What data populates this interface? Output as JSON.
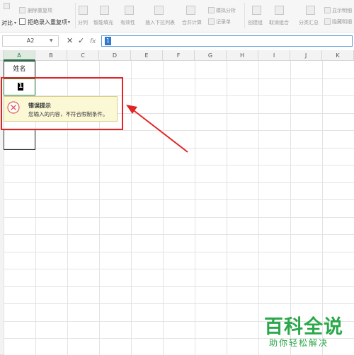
{
  "ribbon": {
    "compare_label": "对比",
    "remove_duplicates": "删除重复项",
    "reject_duplicates": "拒绝录入重复项",
    "split": "分列",
    "smart_fill": "智能填充",
    "validity": "有效性",
    "insert_dropdown": "插入下拉列表",
    "merge_calc": "合并计算",
    "simulate_analysis": "模拟分析",
    "record_form": "记录单",
    "create_group": "创建组",
    "ungroup": "取消组合",
    "subtotal": "分类汇总",
    "show_detail": "显示明细",
    "hide_detail": "隐藏明细"
  },
  "formula_bar": {
    "name_box": "A2",
    "cancel": "✕",
    "confirm": "✓",
    "fx": "fx",
    "value": "1"
  },
  "grid": {
    "columns": [
      "A",
      "B",
      "C",
      "D",
      "E",
      "F",
      "G",
      "H",
      "I",
      "J",
      "K"
    ],
    "cell_a1": "姓名",
    "cell_a2": "1"
  },
  "error_popup": {
    "title": "错误提示",
    "message": "您输入的内容，不符合限制条件。"
  },
  "watermark": {
    "title": "百科全说",
    "subtitle": "助你轻松解决"
  },
  "colors": {
    "annotation": "#e32426",
    "watermark": "#2aa84a",
    "selection": "#2e8b3a"
  }
}
